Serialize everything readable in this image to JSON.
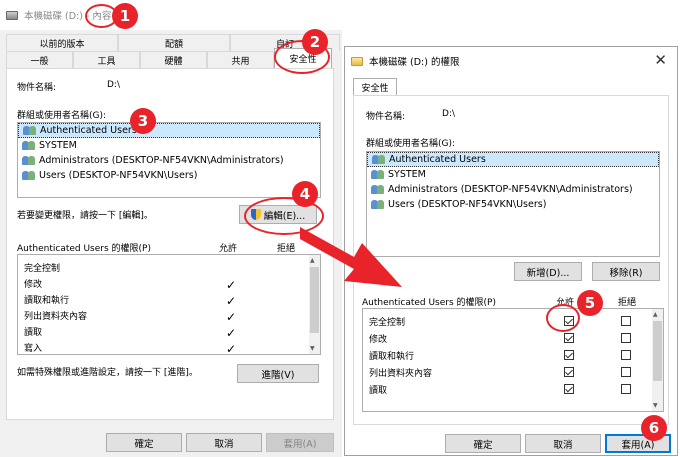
{
  "left_window": {
    "title": "本機磁碟 (D:) - 內容",
    "tabs_row1": [
      "以前的版本",
      "配額",
      "自訂"
    ],
    "tabs_row2": [
      "一般",
      "工具",
      "硬體",
      "共用",
      "安全性"
    ],
    "object_name_label": "物件名稱:",
    "object_name_value": "D:\\",
    "groups_label": "群組或使用者名稱(G):",
    "users": [
      "Authenticated Users",
      "SYSTEM",
      "Administrators (DESKTOP-NF54VKN\\Administrators)",
      "Users (DESKTOP-NF54VKN\\Users)"
    ],
    "change_perm_text": "若要變更權限，請按一下 [編輯]。",
    "edit_button": "編輯(E)...",
    "perm_header": "Authenticated Users 的權限(P)",
    "allow_header": "允許",
    "deny_header": "拒絕",
    "permissions": [
      "完全控制",
      "修改",
      "讀取和執行",
      "列出資料夾內容",
      "讀取",
      "寫入"
    ],
    "advanced_text": "如需特殊權限或進階設定，請按一下 [進階]。",
    "advanced_button": "進階(V)",
    "ok_button": "確定",
    "cancel_button": "取消",
    "apply_button": "套用(A)"
  },
  "right_window": {
    "title": "本機磁碟 (D:) 的權限",
    "tab": "安全性",
    "object_name_label": "物件名稱:",
    "object_name_value": "D:\\",
    "groups_label": "群組或使用者名稱(G):",
    "users": [
      "Authenticated Users",
      "SYSTEM",
      "Administrators (DESKTOP-NF54VKN\\Administrators)",
      "Users (DESKTOP-NF54VKN\\Users)"
    ],
    "add_button": "新增(D)...",
    "remove_button": "移除(R)",
    "perm_header": "Authenticated Users 的權限(P)",
    "allow_header": "允許",
    "deny_header": "拒絕",
    "permissions": [
      "完全控制",
      "修改",
      "讀取和執行",
      "列出資料夾內容",
      "讀取"
    ],
    "ok_button": "確定",
    "cancel_button": "取消",
    "apply_button": "套用(A)"
  },
  "annotations": [
    "1",
    "2",
    "3",
    "4",
    "5",
    "6"
  ],
  "colors": {
    "annotation": "#e8232a",
    "selection": "#cce8ff",
    "focus": "#0078d7"
  }
}
